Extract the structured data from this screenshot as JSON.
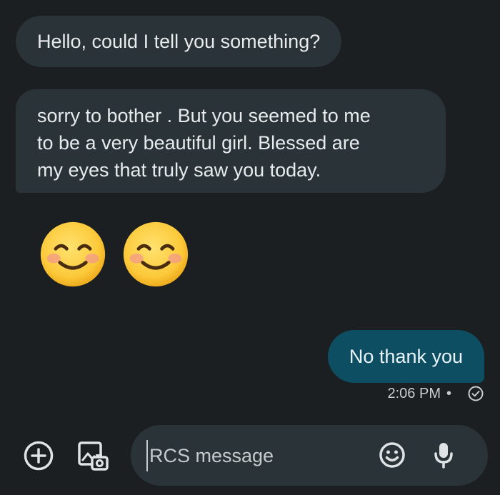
{
  "messages": {
    "incoming": [
      {
        "text": "Hello, could I tell you something?"
      },
      {
        "lines": [
          "sorry to bother . But you seemed to me",
          "to be a very beautiful girl. Blessed are",
          "my eyes that truly saw you today."
        ]
      }
    ],
    "emoji_message": {
      "emojis": [
        "smiling-face-with-smiling-eyes",
        "smiling-face-with-smiling-eyes"
      ]
    },
    "outgoing": {
      "text": "No thank you",
      "time": "2:06 PM",
      "separator": "•",
      "status_icon": "delivered-check-icon"
    }
  },
  "composer": {
    "placeholder": "RCS message",
    "add_icon": "plus-circle-icon",
    "gallery_icon": "gallery-camera-icon",
    "emoji_icon": "emoji-icon",
    "mic_icon": "mic-icon"
  },
  "colors": {
    "background": "#1b1f22",
    "incoming_bubble": "#2a3337",
    "outgoing_bubble": "#0e4e63",
    "text": "#e8ebee"
  }
}
